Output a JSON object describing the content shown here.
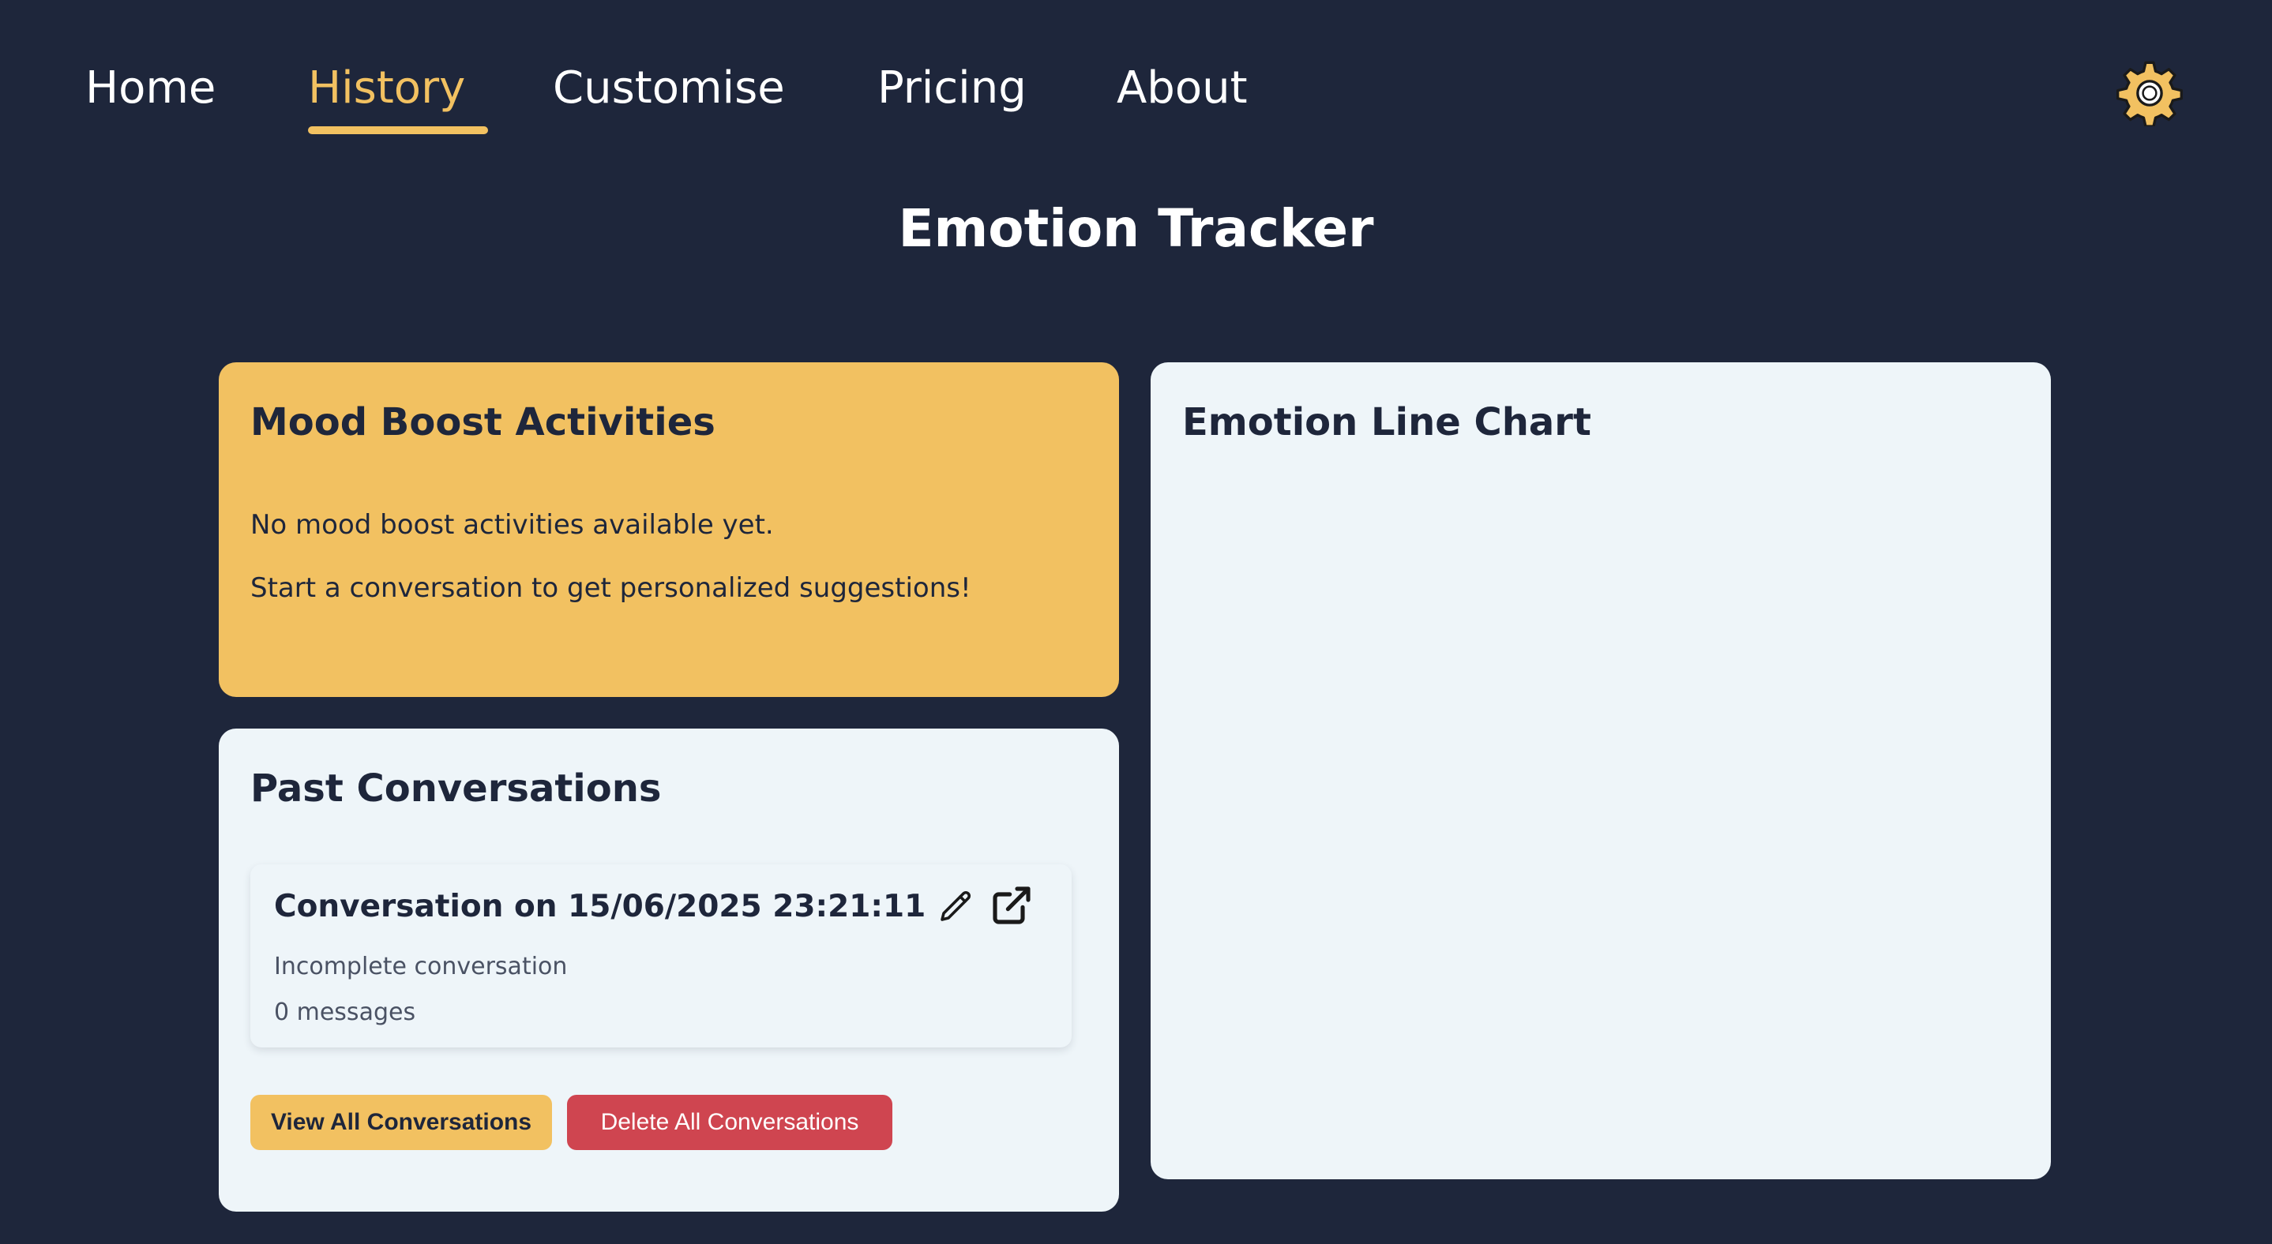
{
  "nav": {
    "items": [
      {
        "label": "Home",
        "active": false
      },
      {
        "label": "History",
        "active": true
      },
      {
        "label": "Customise",
        "active": false
      },
      {
        "label": "Pricing",
        "active": false
      },
      {
        "label": "About",
        "active": false
      }
    ],
    "settings_icon": "gear-icon"
  },
  "page": {
    "title": "Emotion Tracker"
  },
  "mood_boost": {
    "title": "Mood Boost Activities",
    "empty_line1": "No mood boost activities available yet.",
    "empty_line2": "Start a conversation to get personalized suggestions!"
  },
  "past_conversations": {
    "title": "Past Conversations",
    "items": [
      {
        "title": "Conversation on 15/06/2025 23:21:11",
        "status": "Incomplete conversation",
        "message_count": "0 messages",
        "edit_icon": "pencil-icon",
        "open_icon": "external-link-icon"
      }
    ],
    "view_all_label": "View All Conversations",
    "delete_all_label": "Delete All Conversations"
  },
  "emotion_chart": {
    "title": "Emotion Line Chart"
  },
  "colors": {
    "background": "#1e263b",
    "accent": "#f2c161",
    "card": "#eef5f9",
    "danger": "#cf4550"
  }
}
